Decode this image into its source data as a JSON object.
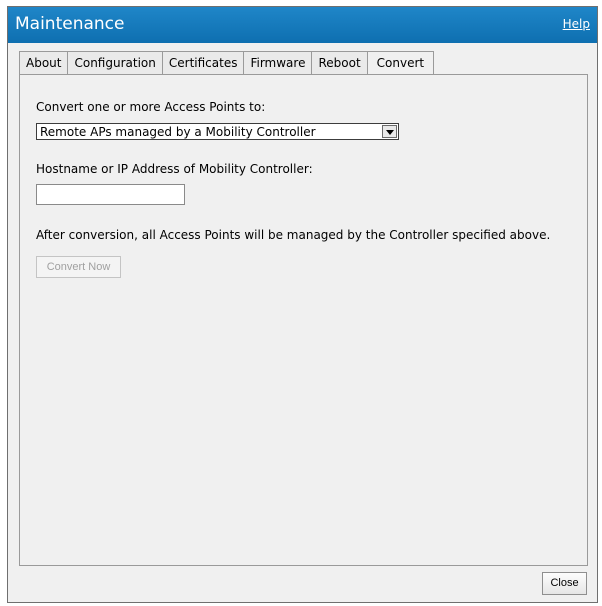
{
  "window": {
    "title": "Maintenance",
    "help_label": "Help"
  },
  "tabs": [
    {
      "label": "About"
    },
    {
      "label": "Configuration"
    },
    {
      "label": "Certificates"
    },
    {
      "label": "Firmware"
    },
    {
      "label": "Reboot"
    },
    {
      "label": "Convert",
      "active": true
    }
  ],
  "convert": {
    "convert_to_label": "Convert one or more Access Points to:",
    "convert_to_selected": "Remote APs managed by a Mobility Controller",
    "hostname_label": "Hostname or IP Address of Mobility Controller:",
    "hostname_value": "",
    "info_text": "After conversion, all Access Points will be managed by the Controller specified above.",
    "convert_button_label": "Convert Now"
  },
  "footer": {
    "close_label": "Close"
  }
}
